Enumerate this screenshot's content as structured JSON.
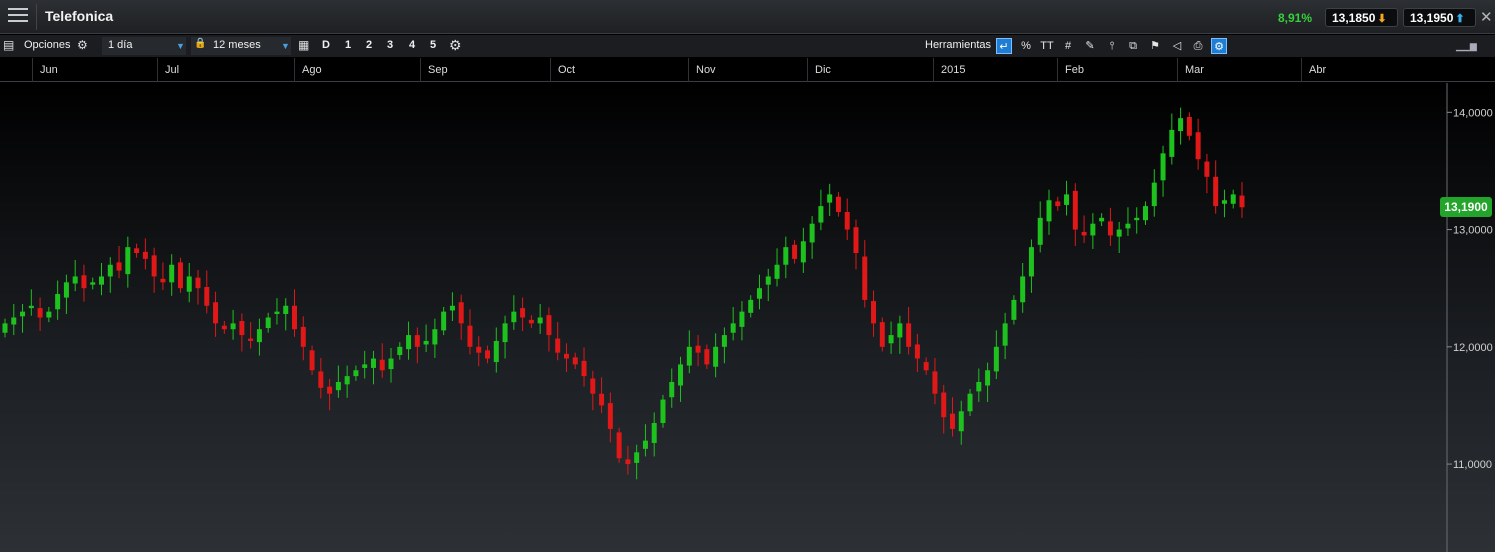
{
  "window": {
    "title": "Telefonica",
    "change_pct": "8,91%",
    "sell_price": "13,1850",
    "buy_price": "13,1950",
    "icons": {
      "menu": "hamburger-menu-icon",
      "close": "close-icon",
      "sell_arrow": "down-arrow-icon",
      "buy_arrow": "up-arrow-icon"
    }
  },
  "toolbar": {
    "options_label": "Opciones",
    "interval_value": "1 día",
    "range_value": "12 meses",
    "quick_ranges": [
      "D",
      "1",
      "2",
      "3",
      "4",
      "5"
    ],
    "tools_label": "Herramientas",
    "tool_icons": [
      "crosshair-toggle-icon",
      "percent-icon",
      "text-size-icon",
      "grid-icon",
      "drawing-icon",
      "candle-icon",
      "compare-icon",
      "indicator-icon",
      "label-icon",
      "print-icon",
      "settings-icon"
    ],
    "tool_percent": "%",
    "tool_text": "TT",
    "tool_grid": "#"
  },
  "colors": {
    "up": "#1ec21e",
    "down": "#e01818",
    "last_price_bg": "#22a52a",
    "accent": "#1f7ed4"
  },
  "chart_data": {
    "type": "candlestick",
    "instrument": "Telefonica",
    "x_label_months": [
      "Jun",
      "Jul",
      "Ago",
      "Sep",
      "Oct",
      "Nov",
      "Dic",
      "2015",
      "Feb",
      "Mar",
      "Abr"
    ],
    "ylim": [
      10.25,
      14.25
    ],
    "y_ticks": [
      11.0,
      12.0,
      13.0,
      14.0
    ],
    "y_tick_labels": [
      "11,0000",
      "12,0000",
      "13,0000",
      "14,0000"
    ],
    "last_price": 13.19,
    "last_price_label": "13,1900",
    "grid": false,
    "closes": [
      12.2,
      12.25,
      12.3,
      12.35,
      12.25,
      12.3,
      12.45,
      12.55,
      12.6,
      12.5,
      12.55,
      12.6,
      12.7,
      12.65,
      12.85,
      12.8,
      12.75,
      12.6,
      12.55,
      12.7,
      12.5,
      12.6,
      12.5,
      12.35,
      12.2,
      12.15,
      12.2,
      12.1,
      12.05,
      12.15,
      12.25,
      12.3,
      12.35,
      12.15,
      12.0,
      11.8,
      11.65,
      11.6,
      11.7,
      11.75,
      11.8,
      11.85,
      11.9,
      11.8,
      11.9,
      12.0,
      12.1,
      12.0,
      12.05,
      12.15,
      12.3,
      12.35,
      12.2,
      12.0,
      11.95,
      11.9,
      12.05,
      12.2,
      12.3,
      12.25,
      12.2,
      12.25,
      12.1,
      11.95,
      11.9,
      11.85,
      11.75,
      11.6,
      11.5,
      11.3,
      11.05,
      11.0,
      11.1,
      11.2,
      11.35,
      11.55,
      11.7,
      11.85,
      12.0,
      11.95,
      11.85,
      12.0,
      12.1,
      12.2,
      12.3,
      12.4,
      12.5,
      12.6,
      12.7,
      12.85,
      12.75,
      12.9,
      13.05,
      13.2,
      13.3,
      13.15,
      13.0,
      12.8,
      12.4,
      12.2,
      12.0,
      12.1,
      12.2,
      12.0,
      11.9,
      11.8,
      11.6,
      11.4,
      11.3,
      11.45,
      11.6,
      11.7,
      11.8,
      12.0,
      12.2,
      12.4,
      12.6,
      12.85,
      13.1,
      13.25,
      13.2,
      13.3,
      13.0,
      12.95,
      13.05,
      13.1,
      12.95,
      13.0,
      13.05,
      13.1,
      13.2,
      13.4,
      13.65,
      13.85,
      13.95,
      13.8,
      13.6,
      13.45,
      13.2,
      13.25,
      13.3,
      13.19
    ]
  }
}
